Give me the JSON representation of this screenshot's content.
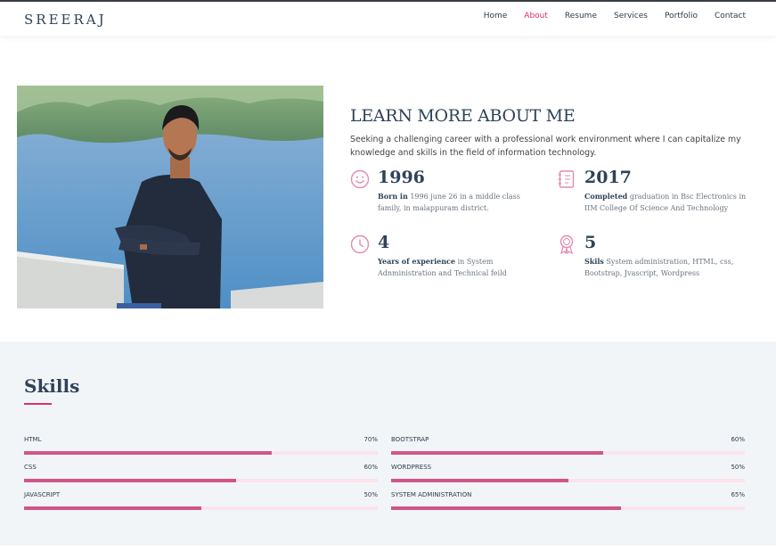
{
  "header": {
    "brand": "SREERAJ",
    "nav": [
      {
        "label": "Home",
        "active": false
      },
      {
        "label": "About",
        "active": true
      },
      {
        "label": "Resume",
        "active": false
      },
      {
        "label": "Services",
        "active": false
      },
      {
        "label": "Portfolio",
        "active": false
      },
      {
        "label": "Contact",
        "active": false
      }
    ]
  },
  "about": {
    "title": "LEARN MORE ABOUT ME",
    "description": "Seeking a challenging career with a professional work environment where I can capitalize my knowledge and skills in the field of information technology.",
    "stats": [
      {
        "icon": "smiley-icon",
        "number": "1996",
        "bold": "Born in",
        "text": " 1996 june 26 in a middle class family, in malappuram district."
      },
      {
        "icon": "journal-icon",
        "number": "2017",
        "bold": "Completed",
        "text": " graduation in Bsc Electronics in IIM College Of Science And Technology"
      },
      {
        "icon": "clock-icon",
        "number": "4",
        "bold": "Years of experience",
        "text": " in System Adnministration and Technical feild"
      },
      {
        "icon": "award-icon",
        "number": "5",
        "bold": "Skils",
        "text": " System administration, HTML, css, Bootstrap, Jvascript, Wordpress"
      }
    ]
  },
  "skills": {
    "title": "Skills",
    "items": [
      {
        "name": "HTML",
        "percent_label": "70%",
        "level": 0.7
      },
      {
        "name": "BOOTSTRAP",
        "percent_label": "60%",
        "level": 0.6
      },
      {
        "name": "CSS",
        "percent_label": "60%",
        "level": 0.6
      },
      {
        "name": "WORDPRESS",
        "percent_label": "50%",
        "level": 0.5
      },
      {
        "name": "JAVASCRIPT",
        "percent_label": "50%",
        "level": 0.5
      },
      {
        "name": "SYSTEM ADMINISTRATION",
        "percent_label": "65%",
        "level": 0.65
      }
    ]
  },
  "colors": {
    "accent": "#d6336c",
    "heading": "#2e4258",
    "icon": "#e48ab0",
    "bar_fill": "#d0568a",
    "bar_track": "#fbe3ec"
  }
}
